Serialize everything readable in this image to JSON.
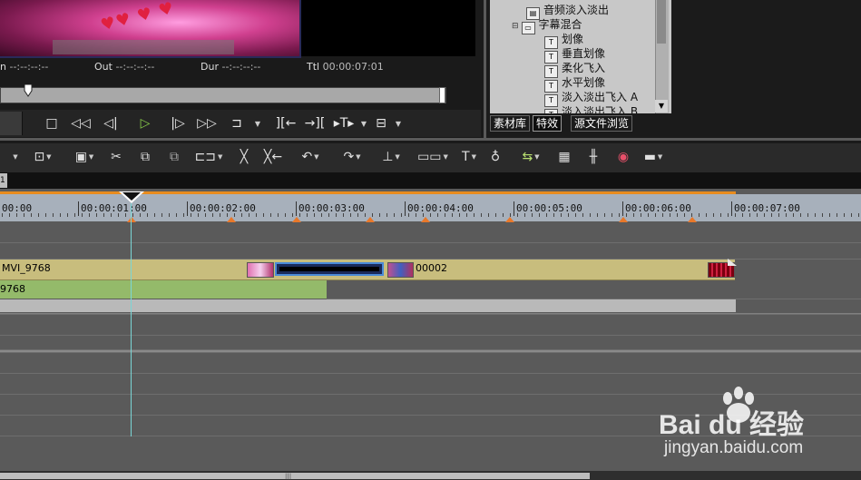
{
  "player": {
    "tc_in_label": "n",
    "tc_in_value": "--:--:--:--",
    "tc_out_label": "Out",
    "tc_out_value": "--:--:--:--",
    "tc_dur_label": "Dur",
    "tc_dur_value": "--:--:--:--",
    "tc_ttl_label": "Ttl",
    "tc_ttl_value": "00:00:07:01"
  },
  "effects_tree": {
    "items": [
      {
        "label": "音频淡入淡出",
        "icon": "folder-icon"
      },
      {
        "label": "字幕混合",
        "icon": "folder-open-icon"
      },
      {
        "label": "划像",
        "icon": "title-effect-icon"
      },
      {
        "label": "垂直划像",
        "icon": "title-effect-icon"
      },
      {
        "label": "柔化飞入",
        "icon": "title-effect-icon"
      },
      {
        "label": "水平划像",
        "icon": "title-effect-icon"
      },
      {
        "label": "淡入淡出飞入 A",
        "icon": "title-effect-icon"
      },
      {
        "label": "淡入淡出飞入 B",
        "icon": "title-effect-icon"
      }
    ],
    "tabs": [
      {
        "label": "素材库"
      },
      {
        "label": "特效",
        "active": true
      },
      {
        "label": "源文件浏览"
      }
    ]
  },
  "timeline": {
    "header_tab": "1",
    "ruler_labels": [
      "00:00",
      "00:00:01:00",
      "00:00:02:00",
      "00:00:03:00",
      "00:00:04:00",
      "00:00:05:00",
      "00:00:06:00",
      "00:00:07:00"
    ],
    "video_clip_label": "MVI_9768",
    "video_clip_label2": "00002",
    "audio_clip_label": "9768"
  },
  "watermark": {
    "logo_text": "Bai  du 经验",
    "url": "jingyan.baidu.com"
  }
}
